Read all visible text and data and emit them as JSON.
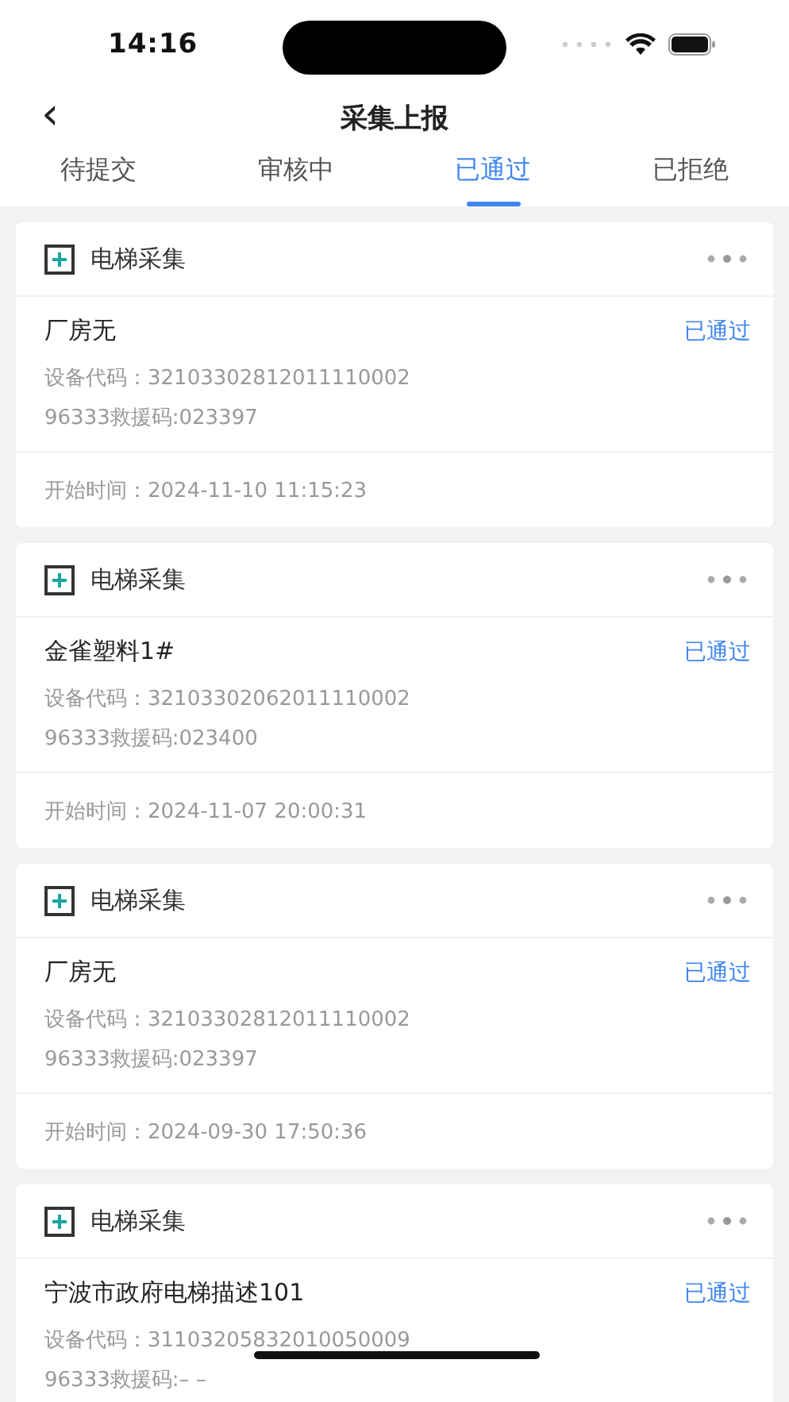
{
  "status_bar": {
    "time": "14:16"
  },
  "nav": {
    "back": "‹",
    "title": "采集上报"
  },
  "tabs": [
    {
      "label": "待提交",
      "selected": false
    },
    {
      "label": "审核中",
      "selected": false
    },
    {
      "label": "已通过",
      "selected": true
    },
    {
      "label": "已拒绝",
      "selected": false
    }
  ],
  "cards": [
    {
      "title": "电梯采集",
      "name": "厂房无",
      "status": "已通过",
      "device_code": "设备代码：32103302812011110002",
      "rescue_code": "96333救援码:023397",
      "start_time": "开始时间：2024-11-10 11:15:23"
    },
    {
      "title": "电梯采集",
      "name": "金雀塑料1#",
      "status": "已通过",
      "device_code": "设备代码：32103302062011110002",
      "rescue_code": "96333救援码:023400",
      "start_time": "开始时间：2024-11-07 20:00:31"
    },
    {
      "title": "电梯采集",
      "name": "厂房无",
      "status": "已通过",
      "device_code": "设备代码：32103302812011110002",
      "rescue_code": "96333救援码:023397",
      "start_time": "开始时间：2024-09-30 17:50:36"
    },
    {
      "title": "电梯采集",
      "name": "宁波市政府电梯描述101",
      "status": "已通过",
      "device_code": "设备代码：31103205832010050009",
      "rescue_code": "96333救援码:– –"
    }
  ]
}
